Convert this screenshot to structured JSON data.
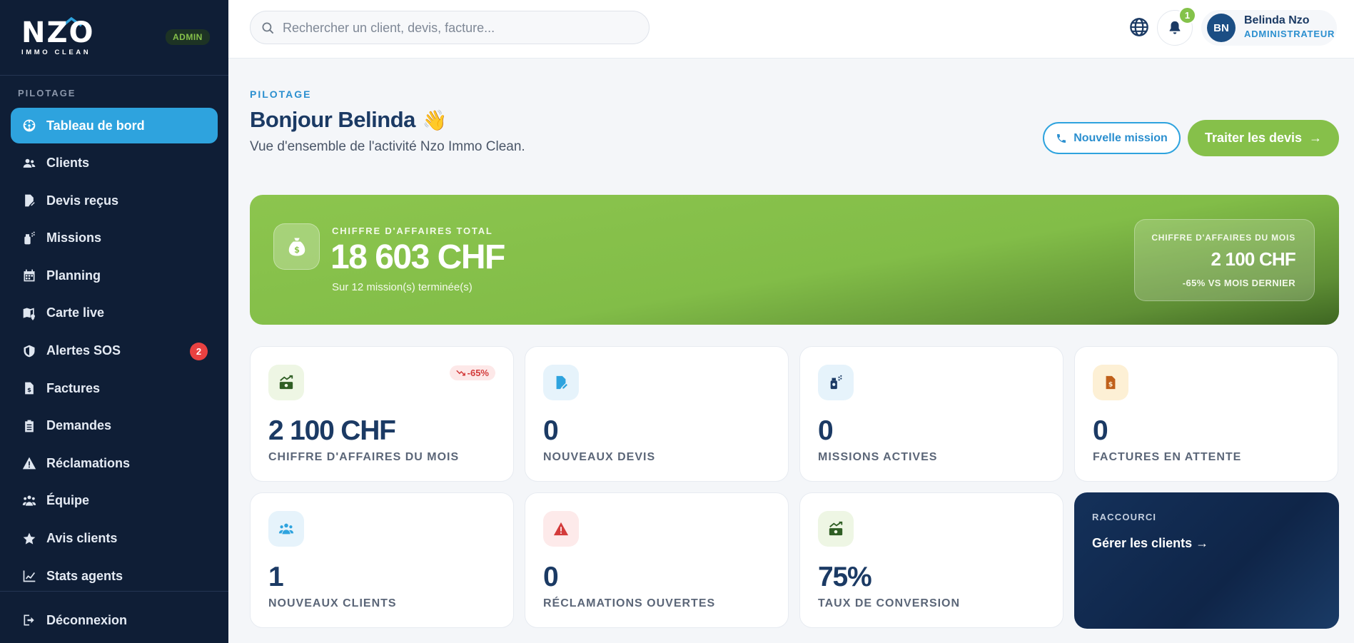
{
  "brand": {
    "logo_text": "NZO",
    "logo_sub": "IMMO CLEAN",
    "role_tag": "ADMIN"
  },
  "sidebar": {
    "section": "PILOTAGE",
    "items": [
      {
        "label": "Tableau de bord",
        "icon": "dashboard-icon",
        "active": true
      },
      {
        "label": "Clients",
        "icon": "users-icon"
      },
      {
        "label": "Devis reçus",
        "icon": "file-pen-icon"
      },
      {
        "label": "Missions",
        "icon": "spray-icon"
      },
      {
        "label": "Planning",
        "icon": "calendar-icon"
      },
      {
        "label": "Carte live",
        "icon": "map-icon"
      },
      {
        "label": "Alertes SOS",
        "icon": "shield-icon",
        "badge": "2"
      },
      {
        "label": "Factures",
        "icon": "invoice-icon"
      },
      {
        "label": "Demandes",
        "icon": "clipboard-icon"
      },
      {
        "label": "Réclamations",
        "icon": "warning-icon"
      },
      {
        "label": "Équipe",
        "icon": "team-icon"
      },
      {
        "label": "Avis clients",
        "icon": "star-icon"
      },
      {
        "label": "Stats agents",
        "icon": "chart-line-icon"
      }
    ],
    "logout": "Déconnexion"
  },
  "header": {
    "search_placeholder": "Rechercher un client, devis, facture...",
    "notification_count": "1",
    "user": {
      "initials": "BN",
      "name": "Belinda Nzo",
      "role": "ADMINISTRATEUR"
    }
  },
  "page": {
    "eyebrow": "PILOTAGE",
    "greeting": "Bonjour Belinda",
    "greeting_emoji": "👋",
    "subtitle": "Vue d'ensemble de l'activité Nzo Immo Clean.",
    "btn_new_mission": "Nouvelle mission",
    "btn_process_quotes": "Traiter les devis",
    "btn_process_quotes_arrow": "→"
  },
  "hero": {
    "label": "CHIFFRE D'AFFAIRES TOTAL",
    "value": "18 603 CHF",
    "sub": "Sur 12 mission(s) terminée(s)",
    "side_label": "CHIFFRE D'AFFAIRES DU MOIS",
    "side_value": "2 100 CHF",
    "side_delta": "-65% VS MOIS DERNIER"
  },
  "cards": [
    {
      "value": "2 100 CHF",
      "label": "CHIFFRE D'AFFAIRES DU MOIS",
      "delta": "-65%"
    },
    {
      "value": "0",
      "label": "NOUVEAUX DEVIS"
    },
    {
      "value": "0",
      "label": "MISSIONS ACTIVES"
    },
    {
      "value": "0",
      "label": "FACTURES EN ATTENTE"
    },
    {
      "value": "1",
      "label": "NOUVEAUX CLIENTS"
    },
    {
      "value": "0",
      "label": "RÉCLAMATIONS OUVERTES"
    },
    {
      "value": "75%",
      "label": "TAUX DE CONVERSION"
    }
  ],
  "shortcut": {
    "label": "RACCOURCI",
    "link": "Gérer les clients →"
  },
  "colors": {
    "sidebar_bg": "#0f1e36",
    "accent_blue": "#2ea3de",
    "accent_green": "#86c04a",
    "navy_text": "#1b3a64",
    "danger": "#e84141"
  }
}
